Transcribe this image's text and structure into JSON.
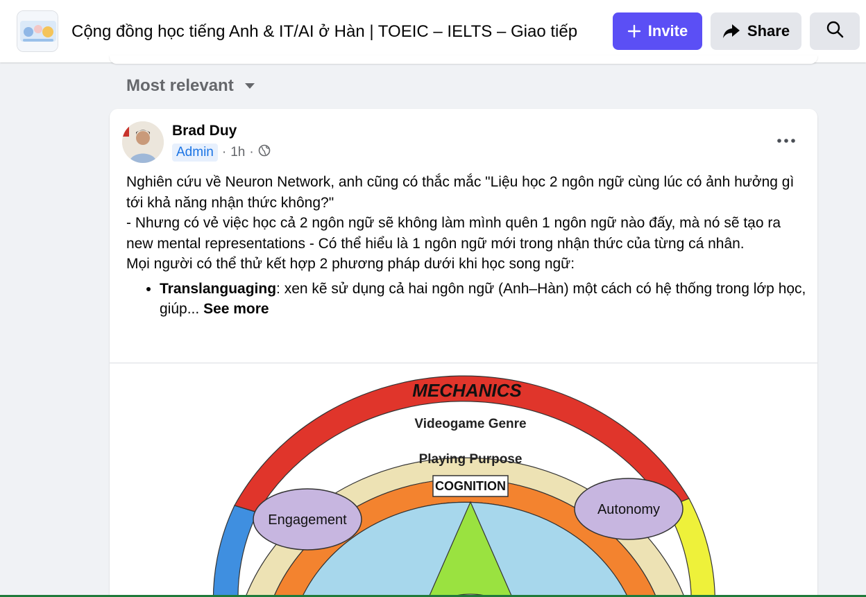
{
  "header": {
    "group_title": "Cộng đồng học tiếng Anh & IT/AI ở Hàn | TOEIC – IELTS – Giao tiếp",
    "invite_label": "Invite",
    "share_label": "Share",
    "accent_color": "#5b4ff5"
  },
  "feed": {
    "sort_label": "Most relevant"
  },
  "post": {
    "author": "Brad Duy",
    "role_badge": "Admin",
    "time": "1h",
    "audience_icon": "globe-icon",
    "paragraph_1": "Nghiên cứu về Neuron Network, anh cũng có thắc mắc \"Liệu học 2 ngôn ngữ cùng lúc có ảnh hưởng gì tới khả năng nhận thức không?\"",
    "paragraph_2": "- Nhưng có vẻ việc học cả 2 ngôn ngữ sẽ không làm mình quên 1 ngôn ngữ nào đấy, mà nó sẽ tạo ra new mental representations - Có thể hiểu là 1 ngôn ngữ mới trong nhận thức của từng cá nhân.",
    "paragraph_3": "Mọi người có thể thử kết hợp 2 phương pháp dưới khi học song ngữ:",
    "bullet_term": "Translanguaging",
    "bullet_text": ": xen kẽ sử dụng cả hai ngôn ngữ (Anh–Hàn) một cách có hệ thống trong lớp học, giúp...",
    "see_more": "See more"
  },
  "diagram": {
    "mechanics": "MECHANICS",
    "genre": "Videogame Genre",
    "purpose": "Playing Purpose",
    "cognition": "COGNITION",
    "engagement": "Engagement",
    "autonomy": "Autonomy"
  }
}
